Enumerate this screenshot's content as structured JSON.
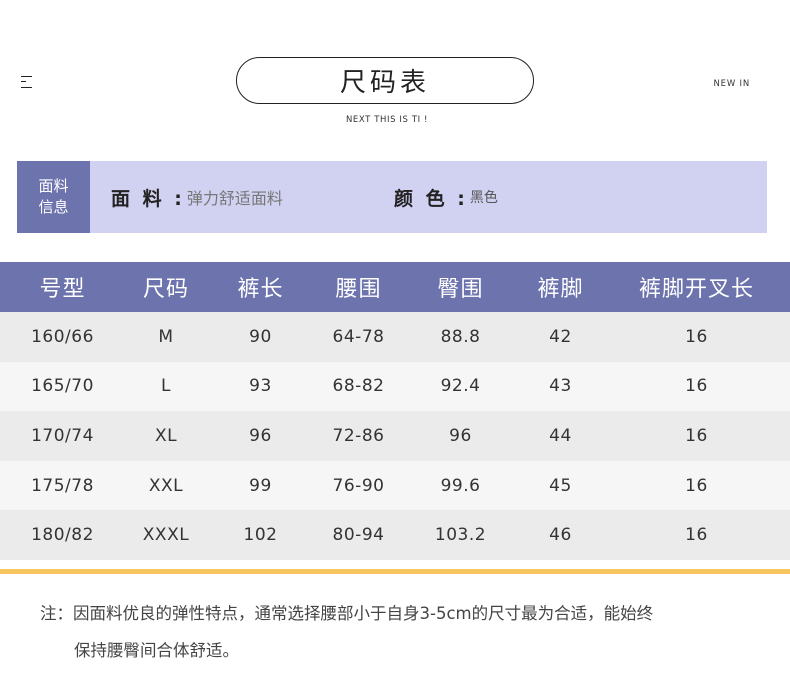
{
  "header": {
    "title": "尺码表",
    "subtitle": "NEXT THIS IS TI !",
    "new_in": "NEW IN"
  },
  "fabric": {
    "label_line1": "面料",
    "label_line2": "信息",
    "material_key": "面 料 :",
    "material_value": "弹力舒适面料",
    "color_key": "颜 色 :",
    "color_value": "黑色"
  },
  "table": {
    "headers": [
      "号型",
      "尺码",
      "裤长",
      "腰围",
      "臀围",
      "裤脚",
      "裤脚开叉长"
    ],
    "rows": [
      [
        "160/66",
        "M",
        "90",
        "64-78",
        "88.8",
        "42",
        "16"
      ],
      [
        "165/70",
        "L",
        "93",
        "68-82",
        "92.4",
        "43",
        "16"
      ],
      [
        "170/74",
        "XL",
        "96",
        "72-86",
        "96",
        "44",
        "16"
      ],
      [
        "175/78",
        "XXL",
        "99",
        "76-90",
        "99.6",
        "45",
        "16"
      ],
      [
        "180/82",
        "XXXL",
        "102",
        "80-94",
        "103.2",
        "46",
        "16"
      ]
    ]
  },
  "note": {
    "line1": "注：因面料优良的弹性特点，通常选择腰部小于自身3-5cm的尺寸最为合适，能始终",
    "line2": "保持腰臀间合体舒适。"
  },
  "colors": {
    "header_purple": "#6c73ad",
    "fabric_bg": "#d1d1f2",
    "accent_yellow": "#f7c55f"
  }
}
